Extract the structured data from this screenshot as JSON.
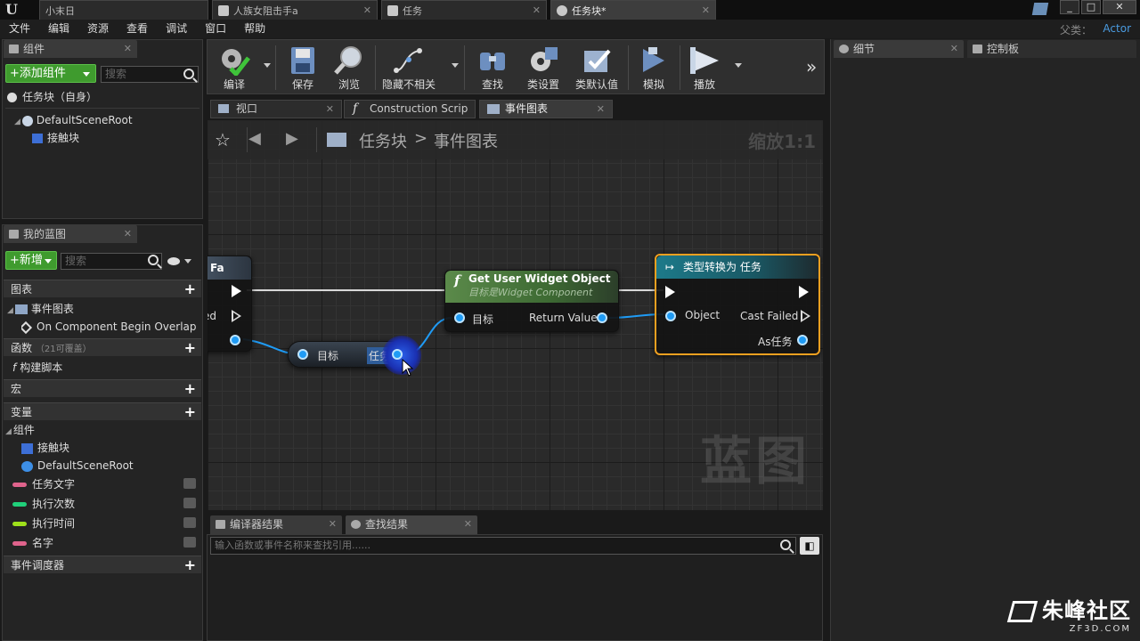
{
  "titlebar": {
    "tabs": [
      {
        "label": "小末日",
        "active": false
      },
      {
        "label": "人族女阻击手a",
        "active": false
      },
      {
        "label": "任务",
        "active": false
      },
      {
        "label": "任务块*",
        "active": true
      }
    ],
    "window_controls": [
      "_",
      "□",
      "✕"
    ]
  },
  "menubar": {
    "items": [
      "文件",
      "编辑",
      "资源",
      "查看",
      "调试",
      "窗口",
      "帮助"
    ],
    "parent_label": "父类：",
    "parent_value": "Actor"
  },
  "components_panel": {
    "tab_label": "组件",
    "add_button": "+添加组件",
    "search_placeholder": "搜索",
    "self_item": "任务块（自身）",
    "tree": [
      "DefaultSceneRoot",
      "接触块"
    ]
  },
  "my_blueprint_panel": {
    "tab_label": "我的蓝图",
    "new_button": "+新增",
    "search_placeholder": "搜索",
    "sections": {
      "graphs": "图表",
      "event_graph": "事件图表",
      "event_item": "On Component Begin Overlap (",
      "functions": "函数",
      "functions_note": "（21可覆盖）",
      "construct": "构建脚本",
      "macros": "宏",
      "variables": "变量",
      "components": "组件",
      "component_items": [
        "接触块",
        "DefaultSceneRoot"
      ],
      "variables_list": [
        {
          "name": "任务文字",
          "color": "#e0638c"
        },
        {
          "name": "执行次数",
          "color": "#20d07a"
        },
        {
          "name": "执行时间",
          "color": "#9fe01a"
        },
        {
          "name": "名字",
          "color": "#e0638c"
        }
      ],
      "dispatchers": "事件调度器"
    }
  },
  "toolbar": {
    "buttons": [
      "编译",
      "保存",
      "浏览",
      "隐藏不相关",
      "查找",
      "类设置",
      "类默认值",
      "模拟",
      "播放"
    ],
    "overflow": "»"
  },
  "graph_tabs": [
    {
      "label": "视口",
      "active": false
    },
    {
      "label": "Construction Scrip",
      "active": false
    },
    {
      "label": "事件图表",
      "active": true
    }
  ],
  "graph": {
    "breadcrumb_root": "任务块",
    "breadcrumb_sep": ">",
    "breadcrumb_leaf": "事件图表",
    "zoom": "缩放1:1",
    "watermark": "蓝图",
    "event_node": {
      "title_fragment": "Fa",
      "pin_failed": "ailed",
      "pin_out": "手a"
    },
    "getter_node": {
      "pin_in": "目标",
      "pin_out": "任务"
    },
    "widget_node": {
      "title": "Get User Widget Object",
      "subtitle": "目标是Widget Component",
      "pin_in": "目标",
      "pin_out": "Return Value"
    },
    "cast_node": {
      "title": "类型转换为 任务",
      "pin_object": "Object",
      "pin_failed": "Cast Failed",
      "pin_as": "As任务"
    }
  },
  "bottom_tabs": {
    "compiler": "编译器结果",
    "find": "查找结果",
    "find_placeholder": "输入函数或事件名称来查找引用......"
  },
  "right_panel": {
    "details_tab": "细节",
    "palette_tab": "控制板"
  },
  "site_watermark": {
    "name": "朱峰社区",
    "url": "ZF3D.COM"
  }
}
